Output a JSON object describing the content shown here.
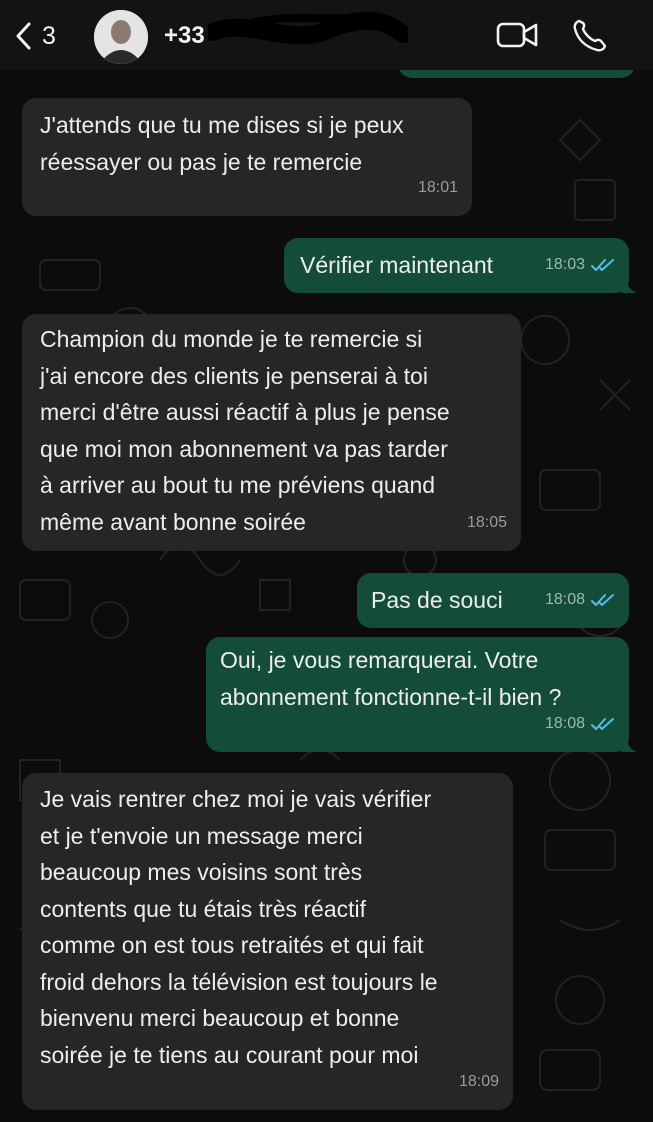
{
  "header": {
    "back_count": "3",
    "contact_name": "+33"
  },
  "colors": {
    "incoming_bubble": "#262626",
    "outgoing_bubble": "#134d37",
    "read_ticks": "#53bdeb"
  },
  "messages": [
    {
      "dir": "in",
      "text": "J'attends que tu me dises si je peux\nréessayer ou pas je te remercie",
      "time": "18:01"
    },
    {
      "dir": "out",
      "text": "Vérifier maintenant",
      "time": "18:03",
      "status": "read"
    },
    {
      "dir": "in",
      "text": "Champion du monde je te remercie si\nj'ai encore des clients je penserai à toi\nmerci d'être aussi réactif à plus je pense\nque moi mon abonnement va pas tarder\nà arriver au bout tu me préviens quand\nmême avant bonne soirée",
      "time": "18:05"
    },
    {
      "dir": "out",
      "text": "Pas de souci",
      "time": "18:08",
      "status": "read"
    },
    {
      "dir": "out",
      "text": "Oui, je vous remarquerai. Votre\nabonnement fonctionne-t-il bien ?",
      "time": "18:08",
      "status": "read"
    },
    {
      "dir": "in",
      "text": "Je vais rentrer chez moi je vais vérifier\net je t'envoie un message merci\nbeaucoup mes voisins sont très\ncontents que tu étais très réactif\ncomme on est tous retraités et qui fait\nfroid dehors la télévision est toujours le\nbienvenu merci beaucoup et bonne\nsoirée je te tiens au courant pour moi",
      "time": "18:09"
    }
  ]
}
